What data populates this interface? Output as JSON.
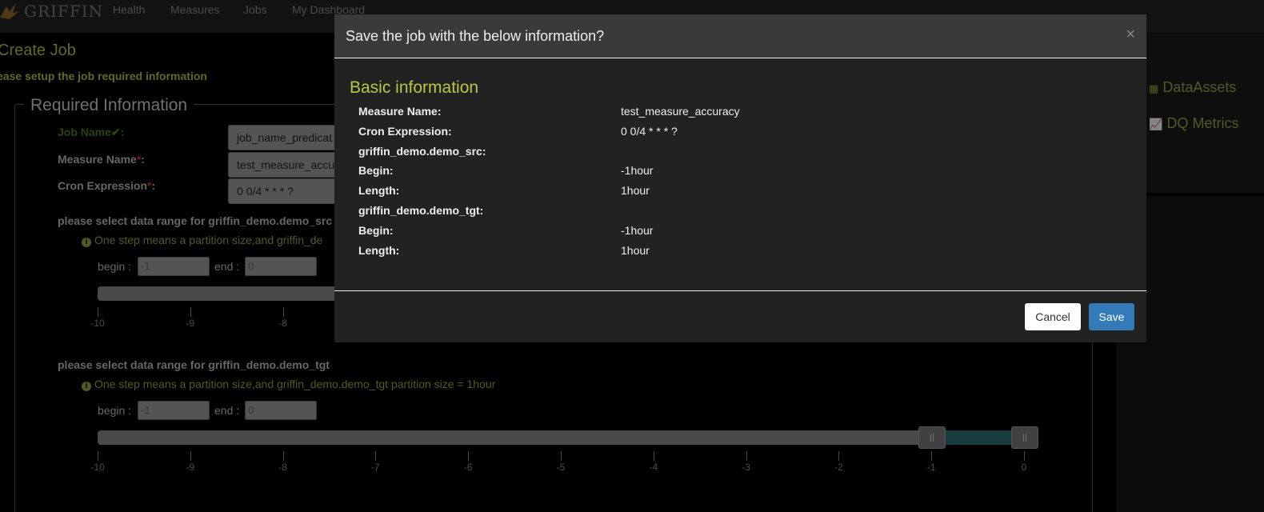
{
  "navbar": {
    "brand": "GRIFFIN",
    "links": [
      "Health",
      "Measures",
      "Jobs",
      "My Dashboard"
    ]
  },
  "page": {
    "title": "Create Job",
    "subtitle": "ease setup the job required information"
  },
  "form": {
    "legend": "Required Information",
    "job_name_label": "Job Name",
    "job_name_check": "✔",
    "job_name_value": "job_name_predicat",
    "measure_name_label": "Measure Name",
    "measure_name_value": "test_measure_accu",
    "cron_label": "Cron Expression",
    "cron_value": "0 0/4 * * * ?",
    "required_mark": "*",
    "colon": ":"
  },
  "ranges": [
    {
      "title": "please select data range for griffin_demo.demo_src",
      "info": "One step means a partition size,and griffin_de",
      "begin_label": "begin :",
      "begin_value": "-1",
      "end_label": "end :",
      "end_value": "0"
    },
    {
      "title": "please select data range for griffin_demo.demo_tgt",
      "info": "One step means a partition size,and griffin_demo.demo_tgt partition size = 1hour",
      "begin_label": "begin :",
      "begin_value": "-1",
      "end_label": "end :",
      "end_value": "0"
    }
  ],
  "slider_ticks": [
    "-10",
    "-9",
    "-8",
    "-7",
    "-6",
    "-5",
    "-4",
    "-3",
    "-2",
    "-1",
    "0"
  ],
  "right_panel": {
    "dataassets": "DataAssets",
    "dq_metrics": "DQ Metrics"
  },
  "modal": {
    "title": "Save the job with the below information?",
    "section": "Basic information",
    "rows": [
      {
        "key": "Measure Name:",
        "value": "test_measure_accuracy"
      },
      {
        "key": "Cron Expression:",
        "value": "0 0/4 * * * ?"
      },
      {
        "key": "griffin_demo.demo_src:",
        "value": ""
      },
      {
        "key": "Begin:",
        "value": "-1hour"
      },
      {
        "key": "Length:",
        "value": "1hour"
      },
      {
        "key": "griffin_demo.demo_tgt:",
        "value": ""
      },
      {
        "key": "Begin:",
        "value": "-1hour"
      },
      {
        "key": "Length:",
        "value": "1hour"
      }
    ],
    "close": "×",
    "cancel": "Cancel",
    "save": "Save"
  },
  "colors": {
    "accent": "#b0c040",
    "primary_button": "#337ab7",
    "slider_selection": "#2a7070"
  }
}
